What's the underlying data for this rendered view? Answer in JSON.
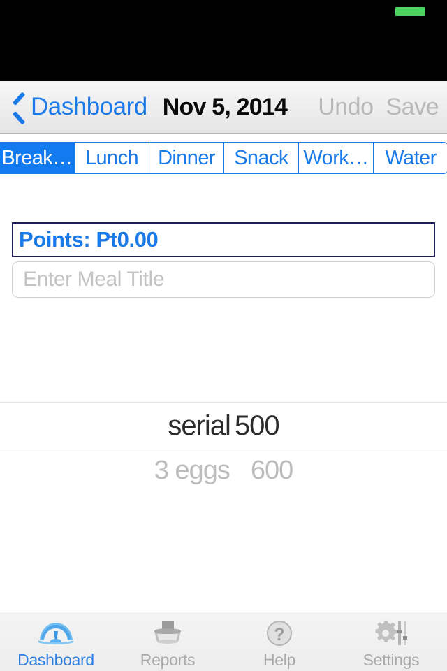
{
  "status_bar": {
    "battery_indicator": "battery-full-green"
  },
  "nav": {
    "back_icon": "chevron-left-icon",
    "back_label": "Dashboard",
    "title": "Nov 5, 2014",
    "undo_label": "Undo",
    "save_label": "Save",
    "accent_color": "#1a7ae8",
    "disabled_color": "#b9b9bc"
  },
  "segments": {
    "selected_index": 0,
    "selected_color": "#127bef",
    "items": [
      {
        "label": "Break…"
      },
      {
        "label": "Lunch"
      },
      {
        "label": "Dinner"
      },
      {
        "label": "Snack"
      },
      {
        "label": "Work…"
      },
      {
        "label": "Water"
      }
    ]
  },
  "points": {
    "label": "Points: Pt0.00",
    "text_color": "#1a7ae8",
    "border_color": "#201f5c"
  },
  "meal_title": {
    "value": "",
    "placeholder": "Enter Meal Title"
  },
  "entries": [
    {
      "name": "serial",
      "value": "500"
    },
    {
      "name": "3 eggs",
      "value": "600"
    }
  ],
  "tab_bar": {
    "active_index": 0,
    "active_color": "#2c7fe0",
    "inactive_color": "#a9a9ac",
    "items": [
      {
        "label": "Dashboard",
        "icon": "gauge-icon"
      },
      {
        "label": "Reports",
        "icon": "printer-icon"
      },
      {
        "label": "Help",
        "icon": "question-circle-icon"
      },
      {
        "label": "Settings",
        "icon": "gear-sliders-icon"
      }
    ]
  }
}
